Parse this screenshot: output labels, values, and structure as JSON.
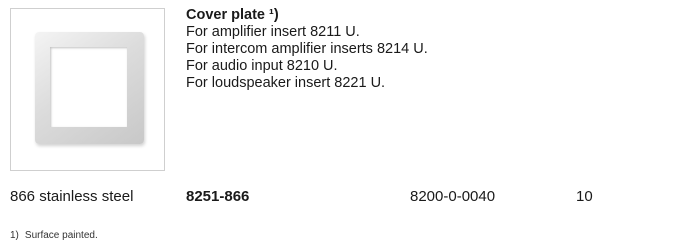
{
  "product": {
    "title": "Cover plate ¹)",
    "lines": [
      "For amplifier insert 8211 U.",
      "For intercom amplifier inserts 8214 U.",
      "For audio input 8210 U.",
      "For loudspeaker insert 8221 U."
    ],
    "image_icon": "cover-plate-image"
  },
  "order_row": {
    "material": "866 stainless steel",
    "article_number": "8251-866",
    "ean": "8200-0-0040",
    "pack_quantity": "10"
  },
  "footnote": {
    "number": "1)",
    "text": "Surface painted."
  }
}
